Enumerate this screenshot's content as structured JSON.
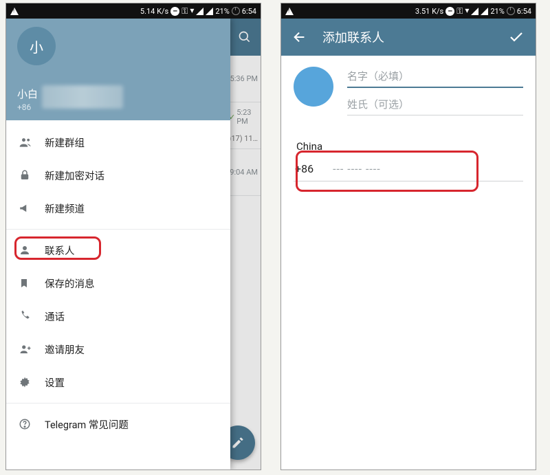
{
  "status_bar_left": {
    "net_speed": "5.14 K/s",
    "net_speed_right": "3.51 K/s"
  },
  "status_bar_right": {
    "battery": "21%",
    "time": "6:54"
  },
  "left_phone": {
    "drawer": {
      "avatar_initial": "小",
      "user_name": "小白",
      "user_phone": "+86",
      "menu": {
        "new_group": "新建群组",
        "new_secret_chat": "新建加密对话",
        "new_channel": "新建频道",
        "contacts": "联系人",
        "saved_messages": "保存的消息",
        "calls": "通话",
        "invite_friends": "邀请朋友",
        "settings": "设置",
        "faq": "Telegram 常见问题"
      }
    },
    "peek_rows": {
      "r0": {
        "time": "5:36 PM"
      },
      "r1": {
        "time": "5:23 PM",
        "snippet": ")17) 11…"
      },
      "r2": {
        "time": "9:04 AM"
      }
    }
  },
  "right_phone": {
    "appbar": {
      "title": "添加联系人"
    },
    "form": {
      "first_name_placeholder": "名字（必填）",
      "last_name_placeholder": "姓氏（可选）",
      "country": "China",
      "phone_code": "+86",
      "phone_placeholder": "--- ---- ----"
    }
  }
}
